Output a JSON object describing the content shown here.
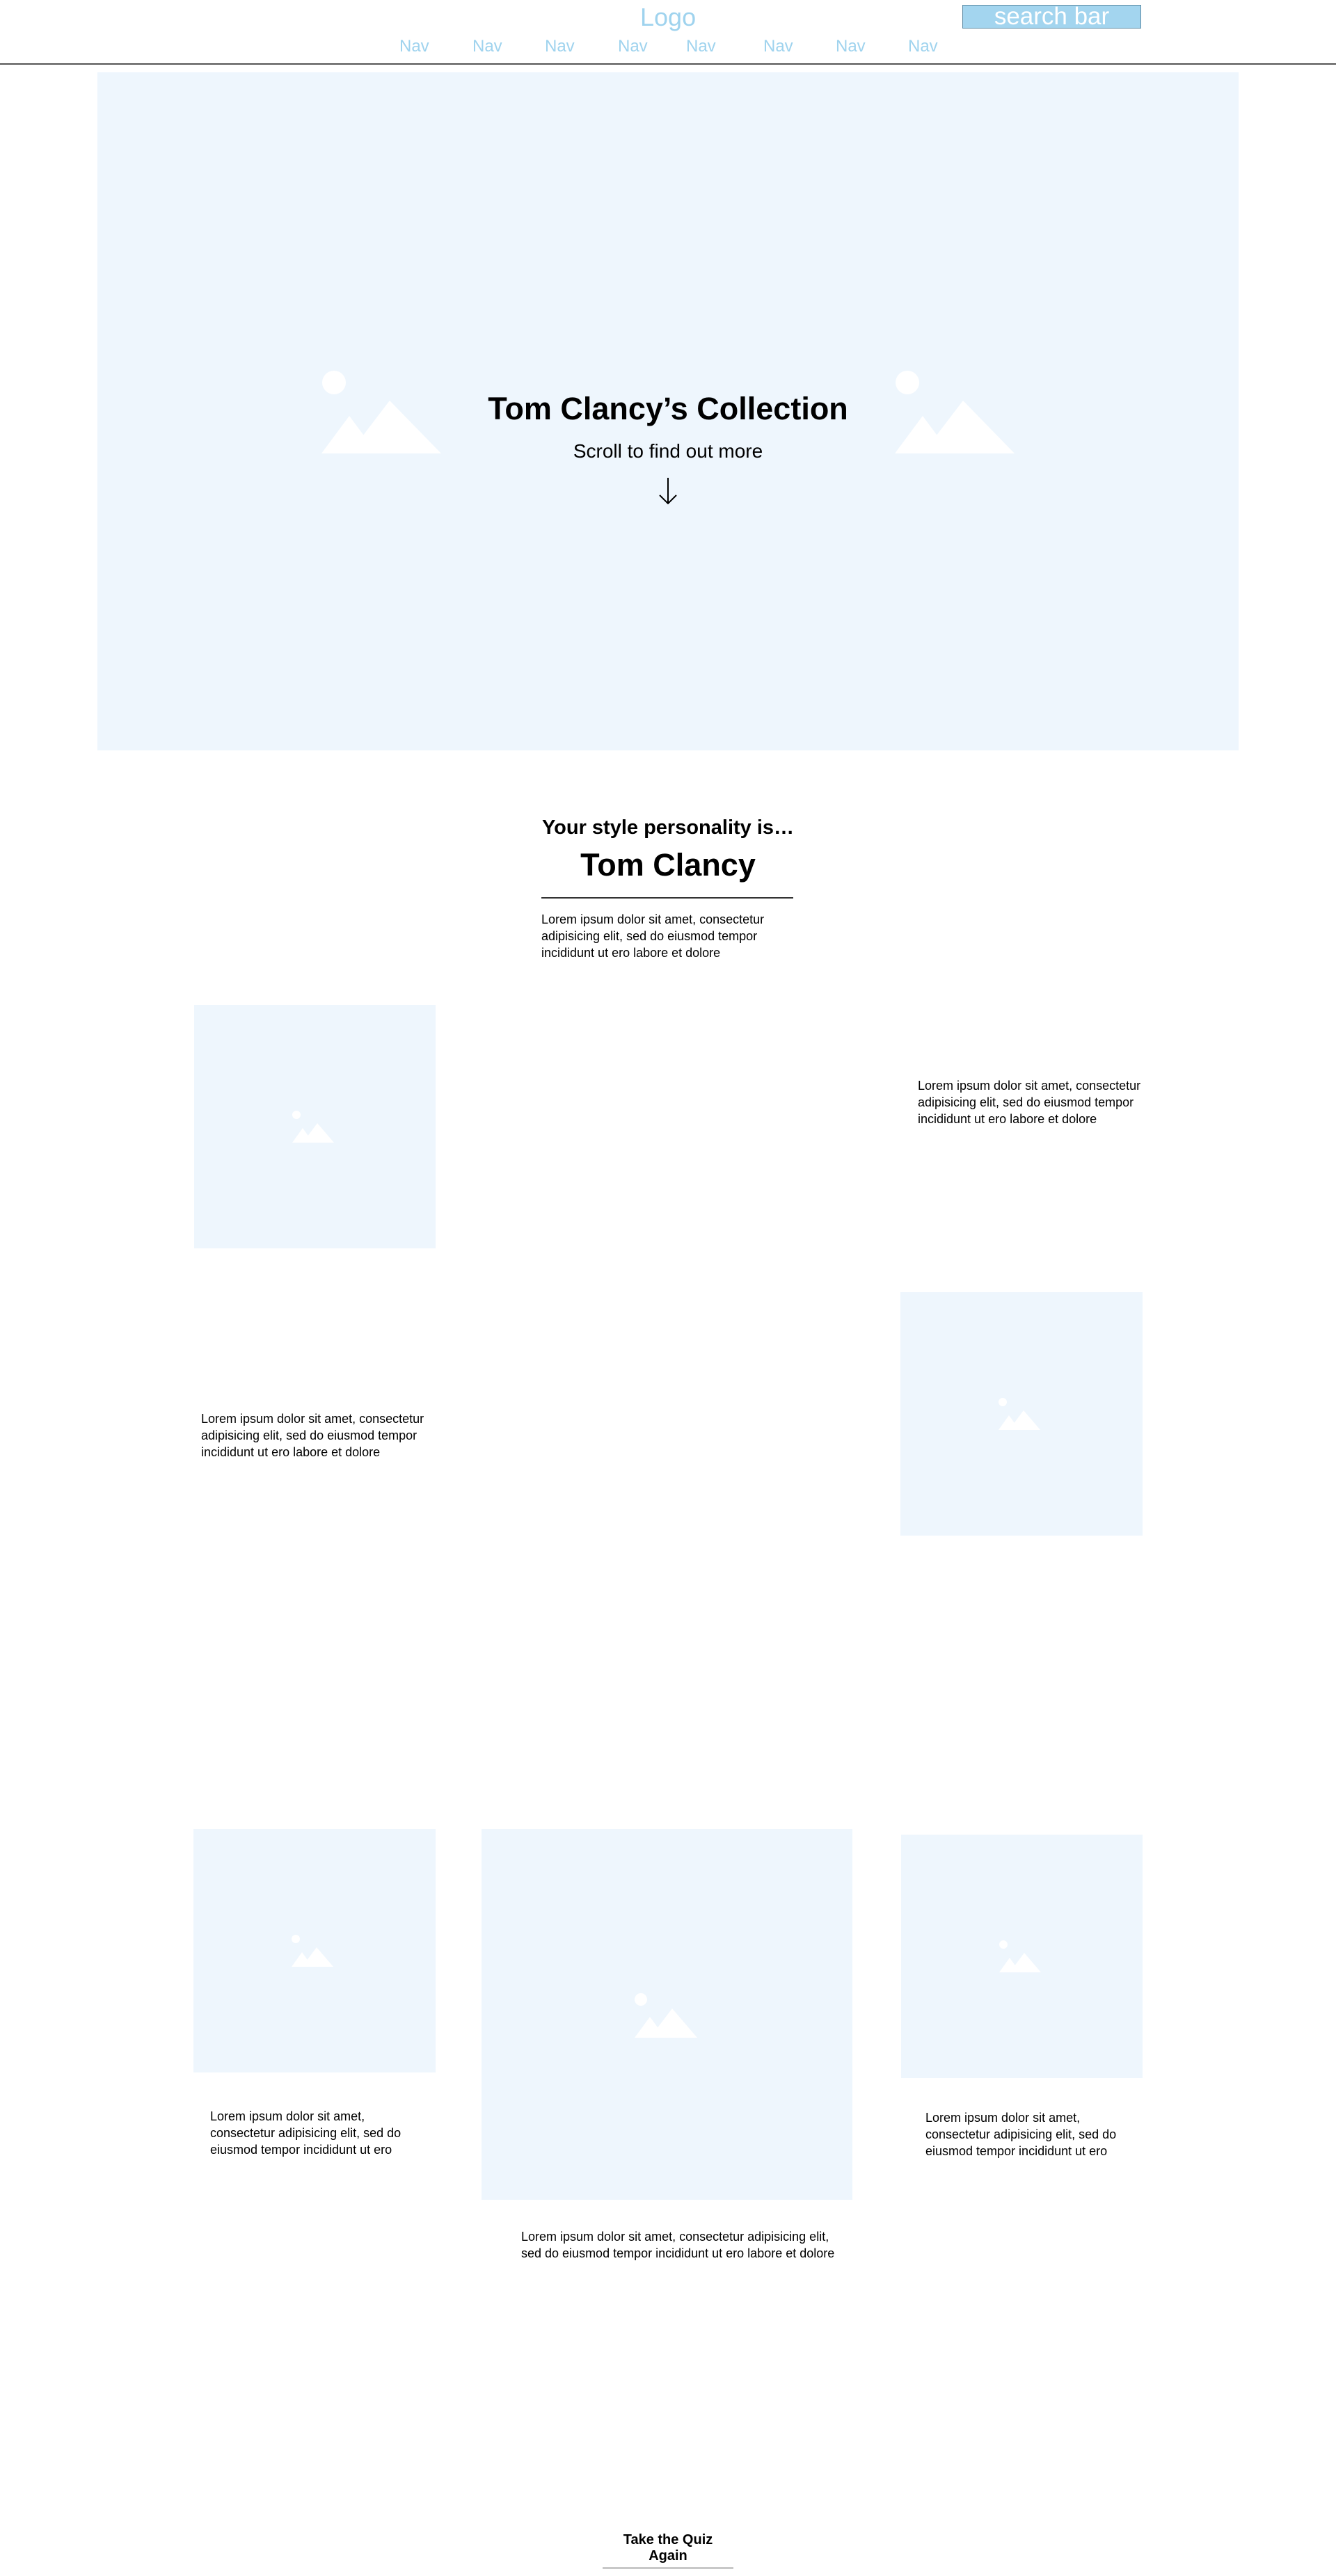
{
  "header": {
    "logo": "Logo",
    "search_placeholder": "search bar",
    "nav": [
      "Nav",
      "Nav",
      "Nav",
      "Nav",
      "Nav",
      "Nav",
      "Nav",
      "Nav"
    ]
  },
  "hero": {
    "title": "Tom Clancy’s Collection",
    "subtitle": "Scroll to find out more",
    "arrow_icon": "arrow-down-icon"
  },
  "result": {
    "kicker": "Your style personality is…",
    "name": "Tom Clancy",
    "text": "Lorem ipsum dolor sit amet, consectetur adipisicing elit, sed do eiusmod tempor incididunt ut ero labore et dolore"
  },
  "feature_rows": [
    {
      "text": "Lorem ipsum dolor sit amet, consectetur adipisicing elit, sed do eiusmod tempor incididunt ut ero labore et dolore"
    },
    {
      "text": "Lorem ipsum dolor sit amet, consectetur adipisicing elit, sed do eiusmod tempor incididunt ut ero labore et dolore"
    }
  ],
  "cards": [
    {
      "text": "Lorem ipsum dolor sit amet, consectetur adipisicing elit, sed do eiusmod tempor incididunt ut ero"
    },
    {
      "text": "Lorem ipsum dolor sit amet, consectetur adipisicing elit, sed do eiusmod tempor incididunt ut ero labore et dolore"
    },
    {
      "text": "Lorem ipsum dolor sit amet, consectetur adipisicing elit, sed do eiusmod tempor incididunt ut ero"
    }
  ],
  "cta": {
    "label": "Take the Quiz Again"
  },
  "colors": {
    "placeholder_bg": "#eef6fd",
    "nav_text": "#9fd3ee",
    "search_bg": "#a3d5ef"
  },
  "icons": {
    "image_placeholder": "image-placeholder-icon"
  }
}
